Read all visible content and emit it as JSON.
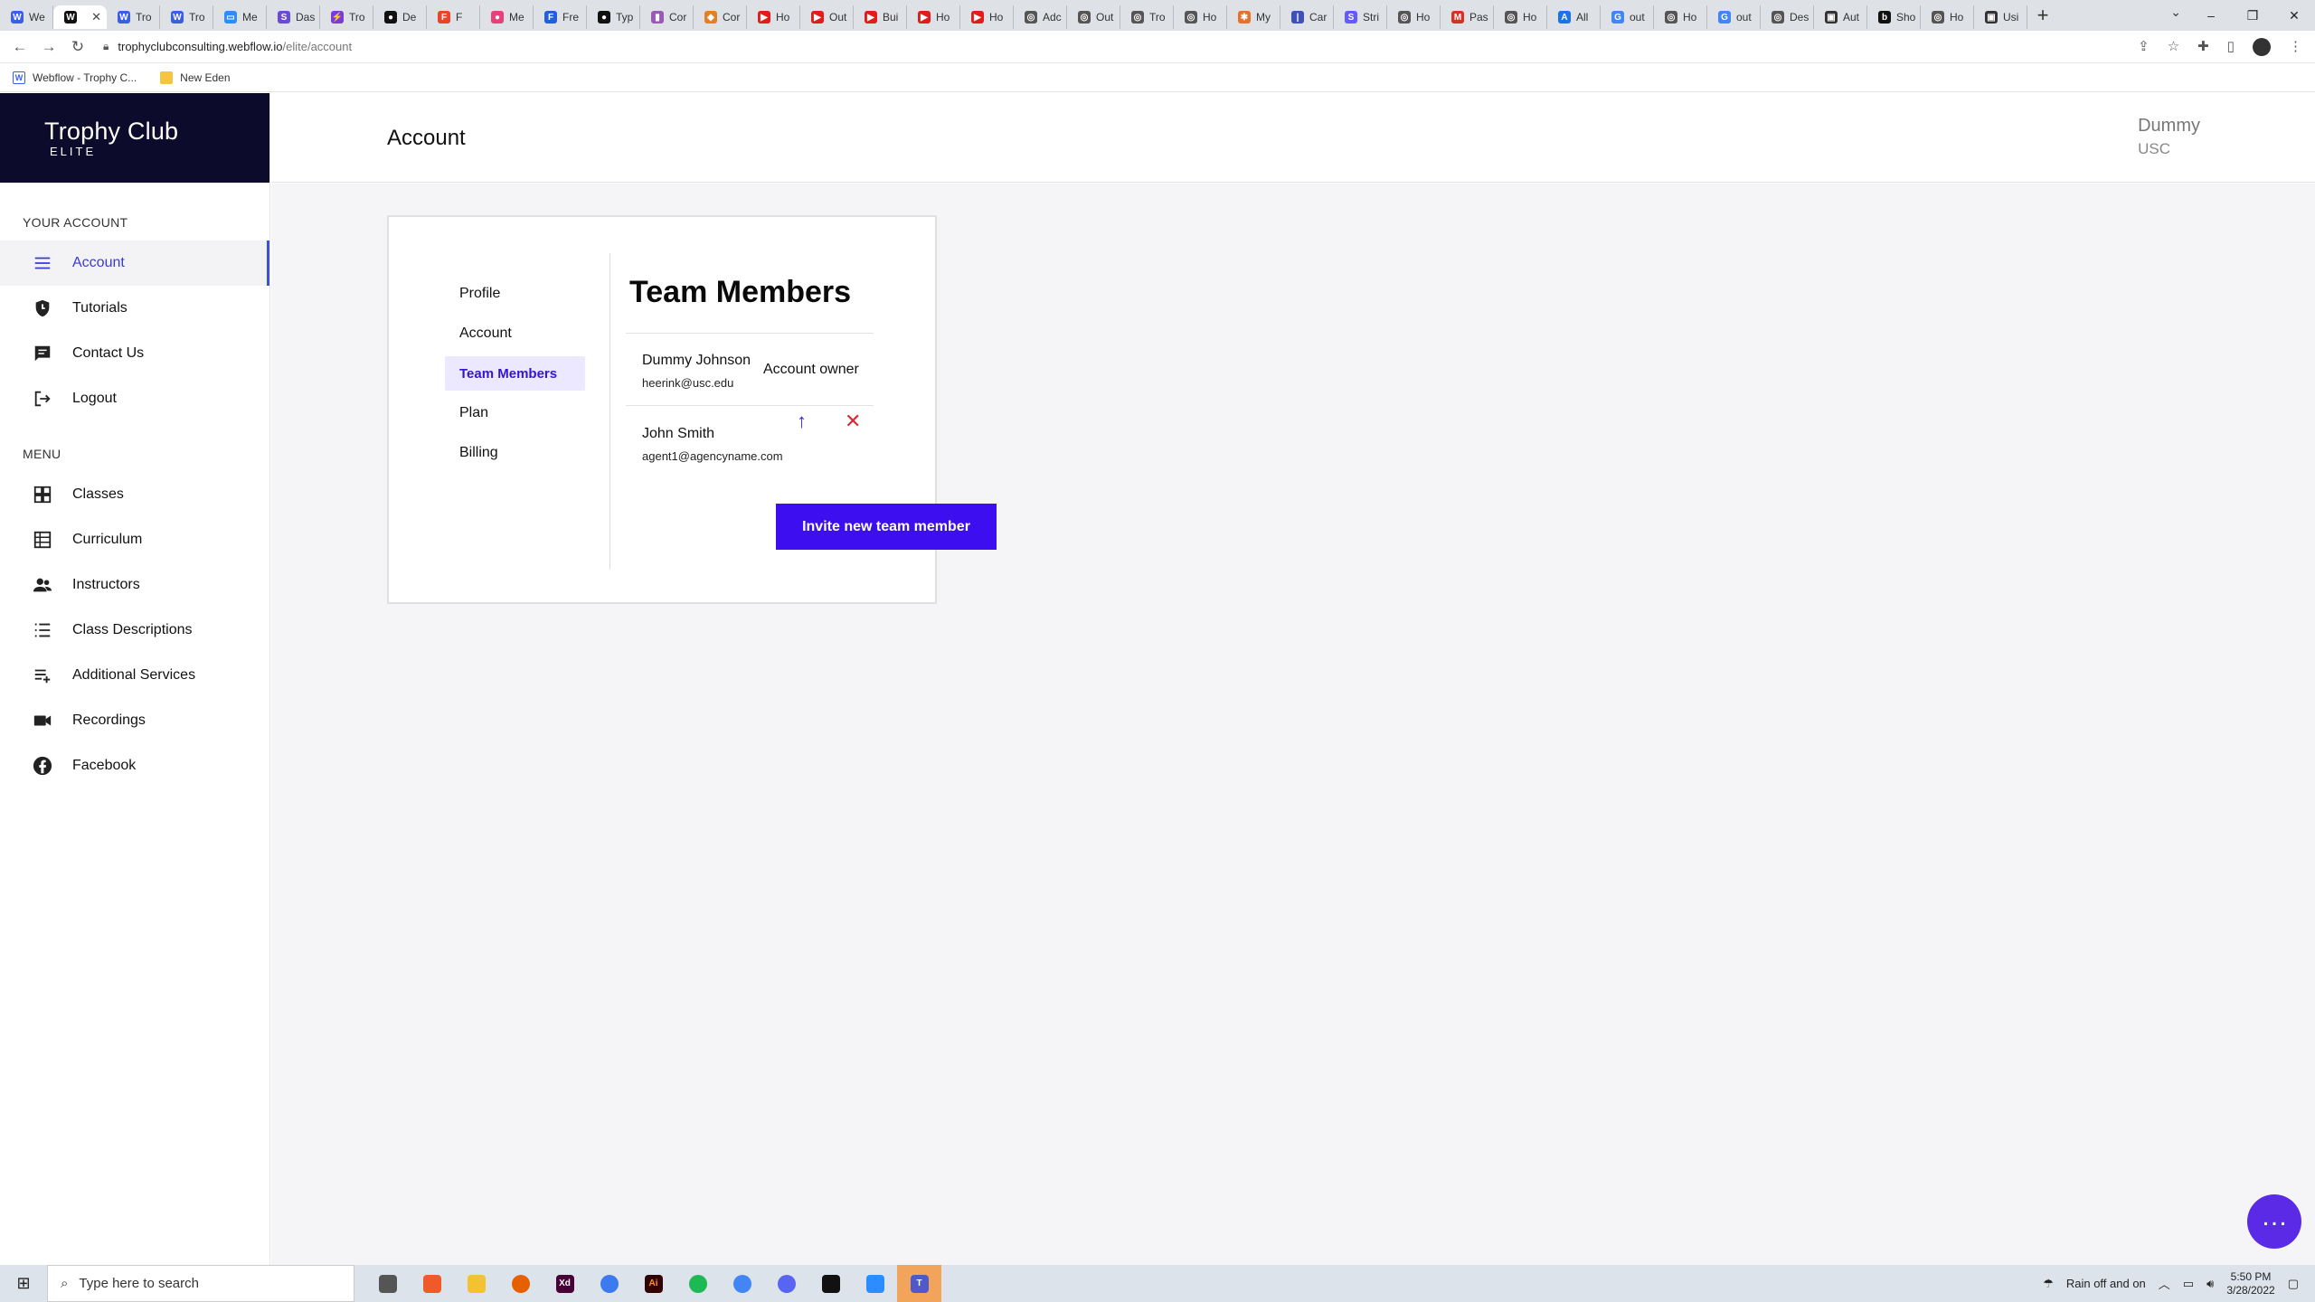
{
  "browser": {
    "tabs": [
      {
        "label": "We",
        "fav": "W",
        "color": "#3a5ee8"
      },
      {
        "label": "",
        "fav": "W",
        "color": "#111111",
        "active": true
      },
      {
        "label": "Tro",
        "fav": "W",
        "color": "#3a5ee8"
      },
      {
        "label": "Tro",
        "fav": "W",
        "color": "#3a5ee8"
      },
      {
        "label": "Me",
        "fav": "▭",
        "color": "#2d8cff"
      },
      {
        "label": "Das",
        "fav": "S",
        "color": "#6a4bd6"
      },
      {
        "label": "Tro",
        "fav": "⚡",
        "color": "#7a3bdb"
      },
      {
        "label": "De",
        "fav": "●",
        "color": "#111111"
      },
      {
        "label": "F",
        "fav": "F",
        "color": "#e8452b"
      },
      {
        "label": "Me",
        "fav": "●",
        "color": "#e9407a"
      },
      {
        "label": "Fre",
        "fav": "F",
        "color": "#2160d8"
      },
      {
        "label": "Typ",
        "fav": "●",
        "color": "#111111"
      },
      {
        "label": "Cor",
        "fav": "▮",
        "color": "#9b59b6"
      },
      {
        "label": "Cor",
        "fav": "◆",
        "color": "#e67e22"
      },
      {
        "label": "Ho",
        "fav": "▶",
        "color": "#e21b1b"
      },
      {
        "label": "Out",
        "fav": "▶",
        "color": "#e21b1b"
      },
      {
        "label": "Bui",
        "fav": "▶",
        "color": "#e21b1b"
      },
      {
        "label": "Ho",
        "fav": "▶",
        "color": "#e21b1b"
      },
      {
        "label": "Ho",
        "fav": "▶",
        "color": "#e21b1b"
      },
      {
        "label": "Adc",
        "fav": "◎",
        "color": "#555555"
      },
      {
        "label": "Out",
        "fav": "◎",
        "color": "#555555"
      },
      {
        "label": "Tro",
        "fav": "◎",
        "color": "#555555"
      },
      {
        "label": "Ho",
        "fav": "◎",
        "color": "#555555"
      },
      {
        "label": "My",
        "fav": "✱",
        "color": "#e8702a"
      },
      {
        "label": "Car",
        "fav": "|",
        "color": "#3f51b5"
      },
      {
        "label": "Stri",
        "fav": "S",
        "color": "#635bff"
      },
      {
        "label": "Ho",
        "fav": "◎",
        "color": "#555555"
      },
      {
        "label": "Pas",
        "fav": "M",
        "color": "#d93025"
      },
      {
        "label": "Ho",
        "fav": "◎",
        "color": "#555555"
      },
      {
        "label": "All",
        "fav": "A",
        "color": "#1a73e8"
      },
      {
        "label": "out",
        "fav": "G",
        "color": "#4285f4"
      },
      {
        "label": "Ho",
        "fav": "◎",
        "color": "#555555"
      },
      {
        "label": "out",
        "fav": "G",
        "color": "#4285f4"
      },
      {
        "label": "Des",
        "fav": "◎",
        "color": "#555555"
      },
      {
        "label": "Aut",
        "fav": "▣",
        "color": "#333333"
      },
      {
        "label": "Sho",
        "fav": "b",
        "color": "#111111"
      },
      {
        "label": "Ho",
        "fav": "◎",
        "color": "#555555"
      },
      {
        "label": "Usi",
        "fav": "▣",
        "color": "#333333"
      }
    ],
    "url_host": "trophyclubconsulting.webflow.io",
    "url_path": "/elite/account",
    "bookmarks": [
      {
        "label": "Webflow - Trophy C...",
        "icon": "W",
        "color": "#3a5ee8"
      },
      {
        "label": "New Eden",
        "icon": "",
        "color": "#f5c542"
      }
    ]
  },
  "sidebar": {
    "brand_title": "Trophy Club",
    "brand_sub": "ELITE",
    "section_account": "YOUR ACCOUNT",
    "account_items": [
      {
        "label": "Account",
        "icon": "menu-icon",
        "active": true
      },
      {
        "label": "Tutorials",
        "icon": "shield-icon"
      },
      {
        "label": "Contact Us",
        "icon": "chat-icon"
      },
      {
        "label": "Logout",
        "icon": "logout-icon"
      }
    ],
    "section_menu": "MENU",
    "menu_items": [
      {
        "label": "Classes",
        "icon": "grid-icon"
      },
      {
        "label": "Curriculum",
        "icon": "table-icon"
      },
      {
        "label": "Instructors",
        "icon": "people-icon"
      },
      {
        "label": "Class Descriptions",
        "icon": "list-icon"
      },
      {
        "label": "Additional Services",
        "icon": "playlist-add-icon"
      },
      {
        "label": "Recordings",
        "icon": "video-icon"
      },
      {
        "label": "Facebook",
        "icon": "facebook-icon"
      }
    ]
  },
  "header": {
    "title": "Account",
    "user_name": "Dummy",
    "user_org": "USC"
  },
  "settings_nav": [
    {
      "label": "Profile"
    },
    {
      "label": "Account"
    },
    {
      "label": "Team Members",
      "active": true
    },
    {
      "label": "Plan"
    },
    {
      "label": "Billing"
    }
  ],
  "team": {
    "title": "Team Members",
    "members": [
      {
        "name": "Dummy Johnson",
        "email": "heerink@usc.edu",
        "role": "Account owner"
      },
      {
        "name": "John Smith",
        "email": "agent1@agencyname.com",
        "role": ""
      }
    ],
    "invite_label": "Invite new team member"
  },
  "taskbar": {
    "search_placeholder": "Type here to search",
    "weather": "Rain off and on",
    "time": "5:50 PM",
    "date": "3/28/2022"
  },
  "colors": {
    "brand_bg": "#0d0b2b",
    "accent": "#3c0ef0",
    "delete": "#e3262e"
  }
}
